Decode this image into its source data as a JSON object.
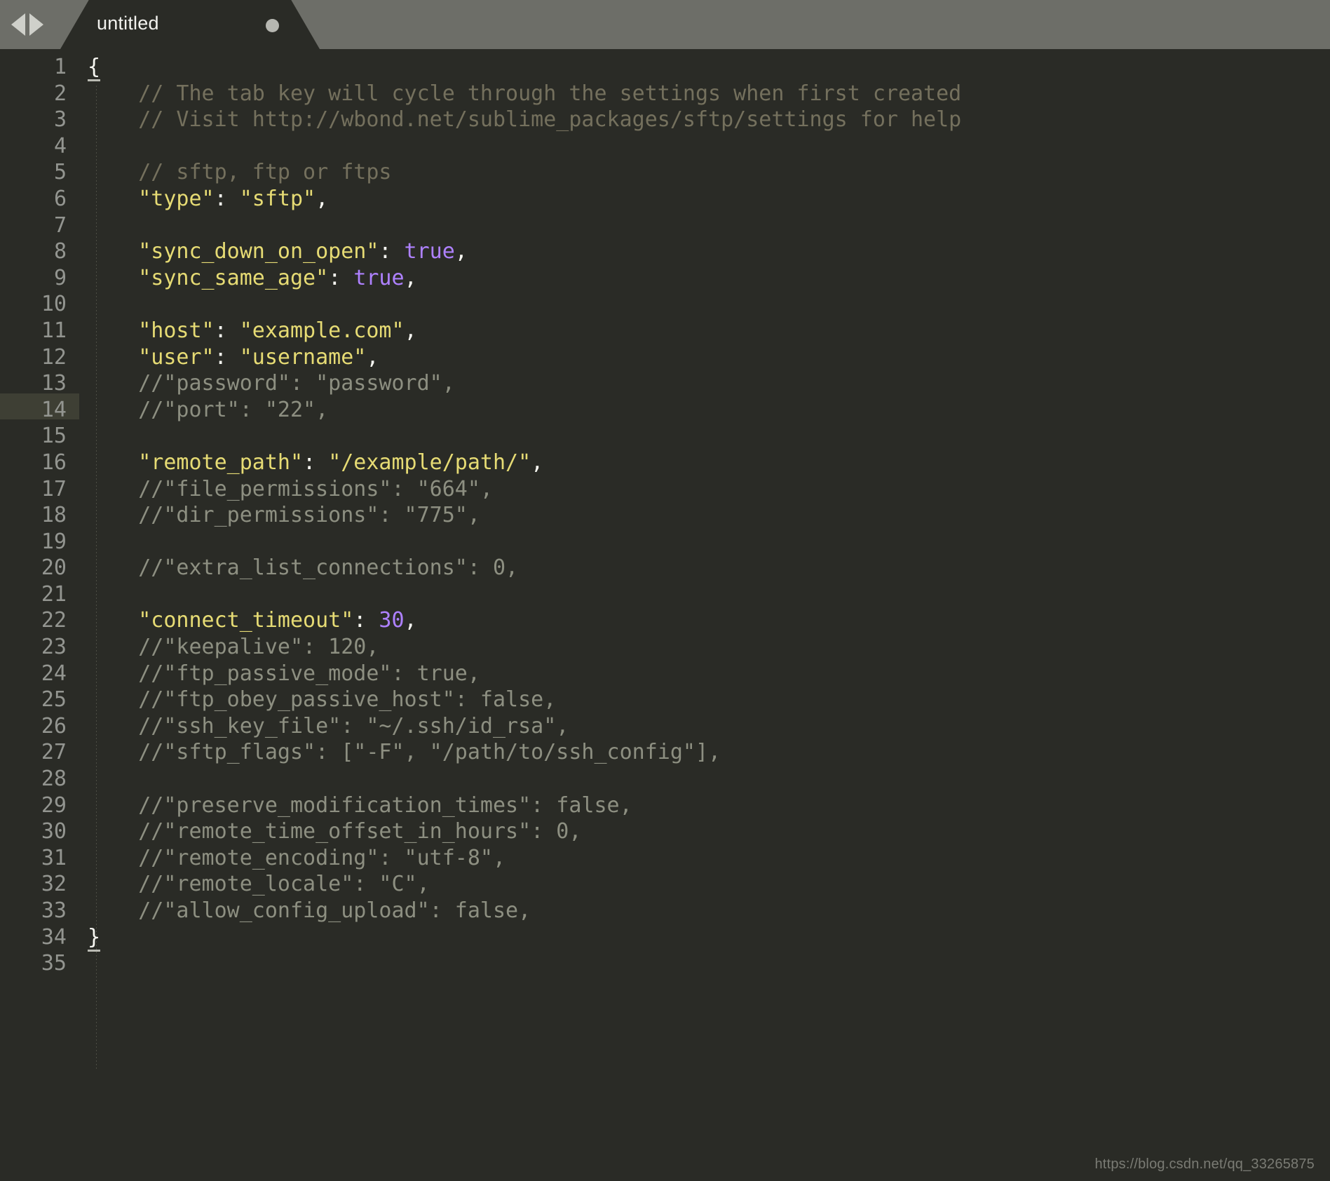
{
  "window": {
    "background_color": "#2a2b26",
    "tabbar_color": "#6d6e68"
  },
  "tabbar": {
    "nav_prev_label": "◀",
    "nav_next_label": "▶",
    "tabs": [
      {
        "label": "untitled",
        "dirty": true,
        "active": true
      }
    ]
  },
  "editor": {
    "active_line": 12,
    "total_lines": 35,
    "language": "JSON",
    "colors": {
      "background": "#2a2b26",
      "gutter_text": "#939590",
      "active_line_band": "#3e3f34",
      "comment": "#74705d",
      "comment_dim": "#8d8f81",
      "key": "#e6db74",
      "string": "#e6db74",
      "constant": "#ae81ff",
      "punctuation": "#f8f8f2"
    },
    "line_numbers": [
      1,
      2,
      3,
      4,
      5,
      6,
      7,
      8,
      9,
      10,
      11,
      12,
      13,
      14,
      15,
      16,
      17,
      18,
      19,
      20,
      21,
      22,
      23,
      24,
      25,
      26,
      27,
      28,
      29,
      30,
      31,
      32,
      33,
      34,
      35
    ],
    "lines": [
      {
        "n": 1,
        "tokens": [
          {
            "t": "brace",
            "v": "{"
          }
        ]
      },
      {
        "n": 2,
        "tokens": [
          {
            "t": "comment",
            "v": "    // The tab key will cycle through the settings when first created"
          }
        ]
      },
      {
        "n": 3,
        "tokens": [
          {
            "t": "comment",
            "v": "    // Visit http://wbond.net/sublime_packages/sftp/settings for help"
          }
        ]
      },
      {
        "n": 4,
        "tokens": []
      },
      {
        "n": 5,
        "tokens": [
          {
            "t": "comment",
            "v": "    // sftp, ftp or ftps"
          }
        ]
      },
      {
        "n": 6,
        "tokens": [
          {
            "t": "plain",
            "v": "    "
          },
          {
            "t": "key",
            "v": "\"type\""
          },
          {
            "t": "punc",
            "v": ": "
          },
          {
            "t": "string",
            "v": "\"sftp\""
          },
          {
            "t": "punc",
            "v": ","
          }
        ]
      },
      {
        "n": 7,
        "tokens": []
      },
      {
        "n": 8,
        "tokens": [
          {
            "t": "plain",
            "v": "    "
          },
          {
            "t": "key",
            "v": "\"sync_down_on_open\""
          },
          {
            "t": "punc",
            "v": ": "
          },
          {
            "t": "const",
            "v": "true"
          },
          {
            "t": "punc",
            "v": ","
          }
        ]
      },
      {
        "n": 9,
        "tokens": [
          {
            "t": "plain",
            "v": "    "
          },
          {
            "t": "key",
            "v": "\"sync_same_age\""
          },
          {
            "t": "punc",
            "v": ": "
          },
          {
            "t": "const",
            "v": "true"
          },
          {
            "t": "punc",
            "v": ","
          }
        ]
      },
      {
        "n": 10,
        "tokens": []
      },
      {
        "n": 11,
        "tokens": [
          {
            "t": "plain",
            "v": "    "
          },
          {
            "t": "key",
            "v": "\"host\""
          },
          {
            "t": "punc",
            "v": ": "
          },
          {
            "t": "string",
            "v": "\"example.com\""
          },
          {
            "t": "punc",
            "v": ","
          }
        ]
      },
      {
        "n": 12,
        "tokens": [
          {
            "t": "plain",
            "v": "    "
          },
          {
            "t": "key",
            "v": "\"user\""
          },
          {
            "t": "punc",
            "v": ": "
          },
          {
            "t": "string",
            "v": "\"username\""
          },
          {
            "t": "punc",
            "v": ","
          }
        ]
      },
      {
        "n": 13,
        "tokens": [
          {
            "t": "comment-dim",
            "v": "    //\"password\": \"password\","
          }
        ]
      },
      {
        "n": 14,
        "tokens": [
          {
            "t": "comment-dim",
            "v": "    //\"port\": \"22\","
          }
        ]
      },
      {
        "n": 15,
        "tokens": []
      },
      {
        "n": 16,
        "tokens": [
          {
            "t": "plain",
            "v": "    "
          },
          {
            "t": "key",
            "v": "\"remote_path\""
          },
          {
            "t": "punc",
            "v": ": "
          },
          {
            "t": "string",
            "v": "\"/example/path/\""
          },
          {
            "t": "punc",
            "v": ","
          }
        ]
      },
      {
        "n": 17,
        "tokens": [
          {
            "t": "comment-dim",
            "v": "    //\"file_permissions\": \"664\","
          }
        ]
      },
      {
        "n": 18,
        "tokens": [
          {
            "t": "comment-dim",
            "v": "    //\"dir_permissions\": \"775\","
          }
        ]
      },
      {
        "n": 19,
        "tokens": []
      },
      {
        "n": 20,
        "tokens": [
          {
            "t": "comment-dim",
            "v": "    //\"extra_list_connections\": 0,"
          }
        ]
      },
      {
        "n": 21,
        "tokens": []
      },
      {
        "n": 22,
        "tokens": [
          {
            "t": "plain",
            "v": "    "
          },
          {
            "t": "key",
            "v": "\"connect_timeout\""
          },
          {
            "t": "punc",
            "v": ": "
          },
          {
            "t": "const",
            "v": "30"
          },
          {
            "t": "punc",
            "v": ","
          }
        ]
      },
      {
        "n": 23,
        "tokens": [
          {
            "t": "comment-dim",
            "v": "    //\"keepalive\": 120,"
          }
        ]
      },
      {
        "n": 24,
        "tokens": [
          {
            "t": "comment-dim",
            "v": "    //\"ftp_passive_mode\": true,"
          }
        ]
      },
      {
        "n": 25,
        "tokens": [
          {
            "t": "comment-dim",
            "v": "    //\"ftp_obey_passive_host\": false,"
          }
        ]
      },
      {
        "n": 26,
        "tokens": [
          {
            "t": "comment-dim",
            "v": "    //\"ssh_key_file\": \"~/.ssh/id_rsa\","
          }
        ]
      },
      {
        "n": 27,
        "tokens": [
          {
            "t": "comment-dim",
            "v": "    //\"sftp_flags\": [\"-F\", \"/path/to/ssh_config\"],"
          }
        ]
      },
      {
        "n": 28,
        "tokens": []
      },
      {
        "n": 29,
        "tokens": [
          {
            "t": "comment-dim",
            "v": "    //\"preserve_modification_times\": false,"
          }
        ]
      },
      {
        "n": 30,
        "tokens": [
          {
            "t": "comment-dim",
            "v": "    //\"remote_time_offset_in_hours\": 0,"
          }
        ]
      },
      {
        "n": 31,
        "tokens": [
          {
            "t": "comment-dim",
            "v": "    //\"remote_encoding\": \"utf-8\","
          }
        ]
      },
      {
        "n": 32,
        "tokens": [
          {
            "t": "comment-dim",
            "v": "    //\"remote_locale\": \"C\","
          }
        ]
      },
      {
        "n": 33,
        "tokens": [
          {
            "t": "comment-dim",
            "v": "    //\"allow_config_upload\": false,"
          }
        ]
      },
      {
        "n": 34,
        "tokens": [
          {
            "t": "brace",
            "v": "}"
          }
        ]
      },
      {
        "n": 35,
        "tokens": []
      }
    ]
  },
  "watermark": {
    "text": "https://blog.csdn.net/qq_33265875"
  }
}
